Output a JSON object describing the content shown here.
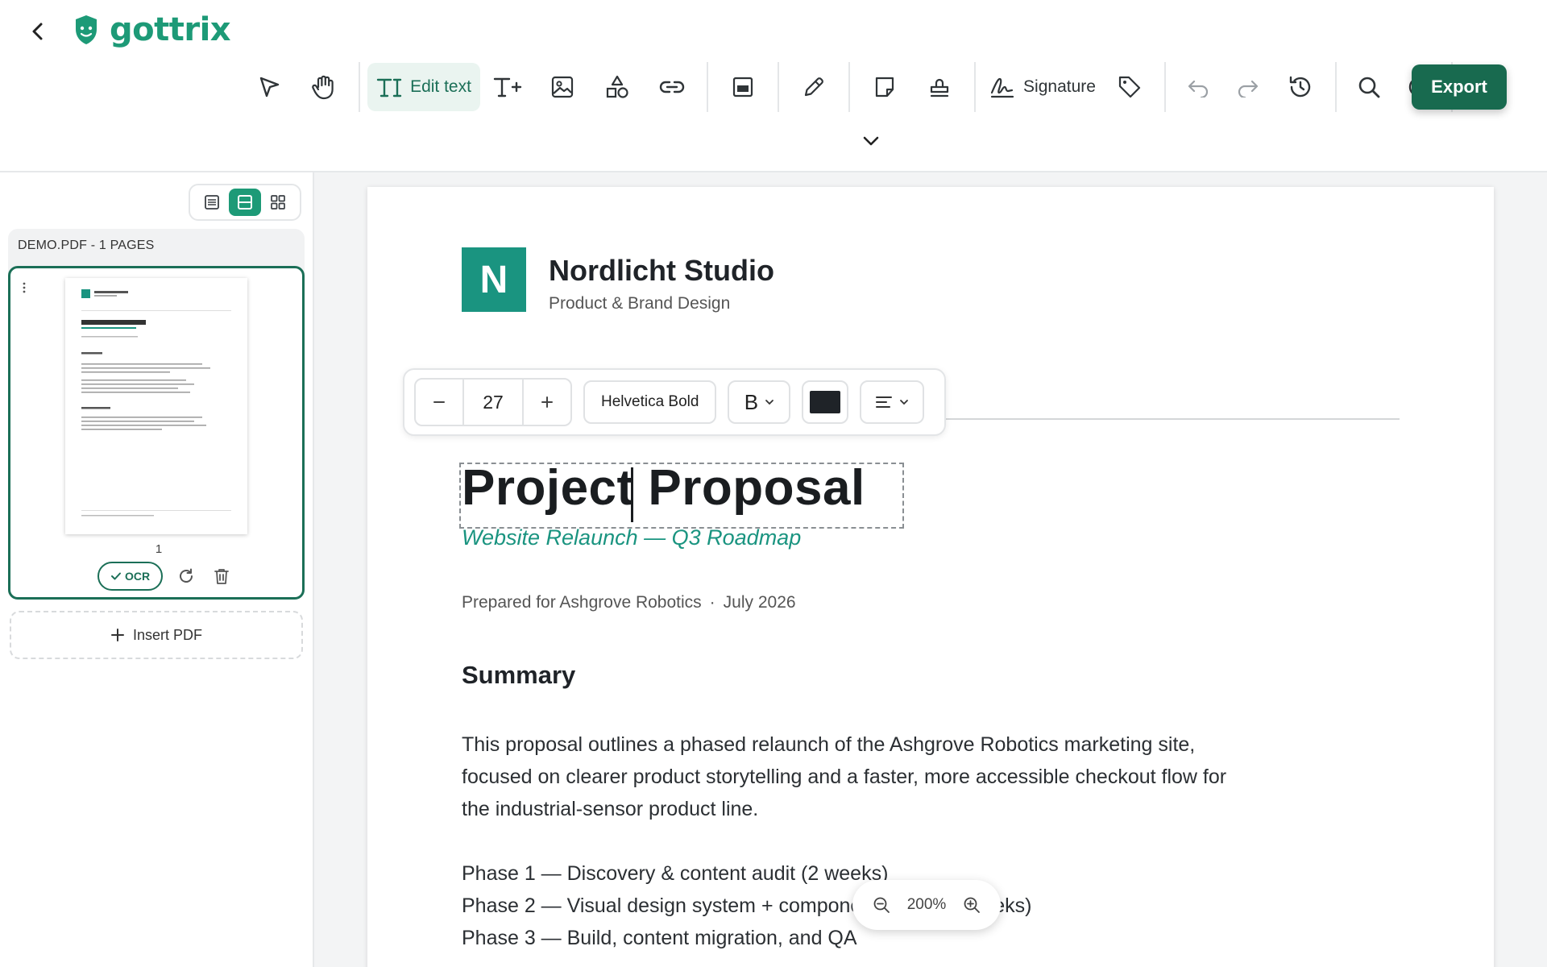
{
  "app": {
    "name": "gottrix",
    "brand_color": "#1d9a77",
    "accent_dark": "#186a4f"
  },
  "toolbar": {
    "items": [
      {
        "name": "select-tool",
        "icon": "cursor-arrow-icon"
      },
      {
        "name": "pan-tool",
        "icon": "hand-icon"
      },
      {
        "name": "edit-text-tool",
        "icon": "text-edit-icon",
        "label": "Edit text",
        "active": true
      },
      {
        "name": "add-text-tool",
        "icon": "text-plus-icon"
      },
      {
        "name": "image-tool",
        "icon": "image-icon"
      },
      {
        "name": "shapes-tool",
        "icon": "shapes-icon"
      },
      {
        "name": "link-tool",
        "icon": "link-icon"
      },
      {
        "name": "redact-tool",
        "icon": "redact-box-icon"
      },
      {
        "name": "draw-tool",
        "icon": "pencil-icon"
      },
      {
        "name": "note-tool",
        "icon": "note-icon"
      },
      {
        "name": "stamp-tool",
        "icon": "stamp-icon"
      },
      {
        "name": "signature-tool",
        "icon": "signature-icon",
        "label": "Signature"
      },
      {
        "name": "tag-tool",
        "icon": "tag-icon"
      },
      {
        "name": "undo",
        "icon": "undo-icon"
      },
      {
        "name": "redo",
        "icon": "redo-icon"
      },
      {
        "name": "history",
        "icon": "history-icon"
      },
      {
        "name": "search",
        "icon": "search-icon"
      },
      {
        "name": "contrast",
        "icon": "contrast-icon"
      }
    ],
    "export_label": "Export"
  },
  "sidebar": {
    "file_label": "DEMO.PDF - 1 PAGES",
    "page_number": "1",
    "ocr_label": "OCR",
    "insert_label": "Insert PDF"
  },
  "format_bar": {
    "font_size": "27",
    "font_family": "Helvetica Bold",
    "style_label": "B",
    "text_color": "#1f2328"
  },
  "document": {
    "brand_letter": "N",
    "brand_name": "Nordlicht Studio",
    "brand_tagline": "Product & Brand Design",
    "title_part1": "Project ",
    "title_part2": "Proposal",
    "subtitle": "Website Relaunch — Q3 Roadmap",
    "meta_prepared": "Prepared for Ashgrove Robotics",
    "meta_sep": "·",
    "meta_date": "July 2026",
    "section_heading": "Summary",
    "paragraph": "This proposal outlines a phased relaunch of the Ashgrove Robotics marketing site, focused on clearer product storytelling and a faster, more accessible checkout flow for the industrial-sensor product line.",
    "phase1": "Phase 1 — Discovery & content audit (2 weeks)",
    "phase2": "Phase 2 — Visual design system + component library (3 weeks)",
    "phase3": "Phase 3 — Build, content migration, and QA"
  },
  "zoom": {
    "level": "200%"
  }
}
